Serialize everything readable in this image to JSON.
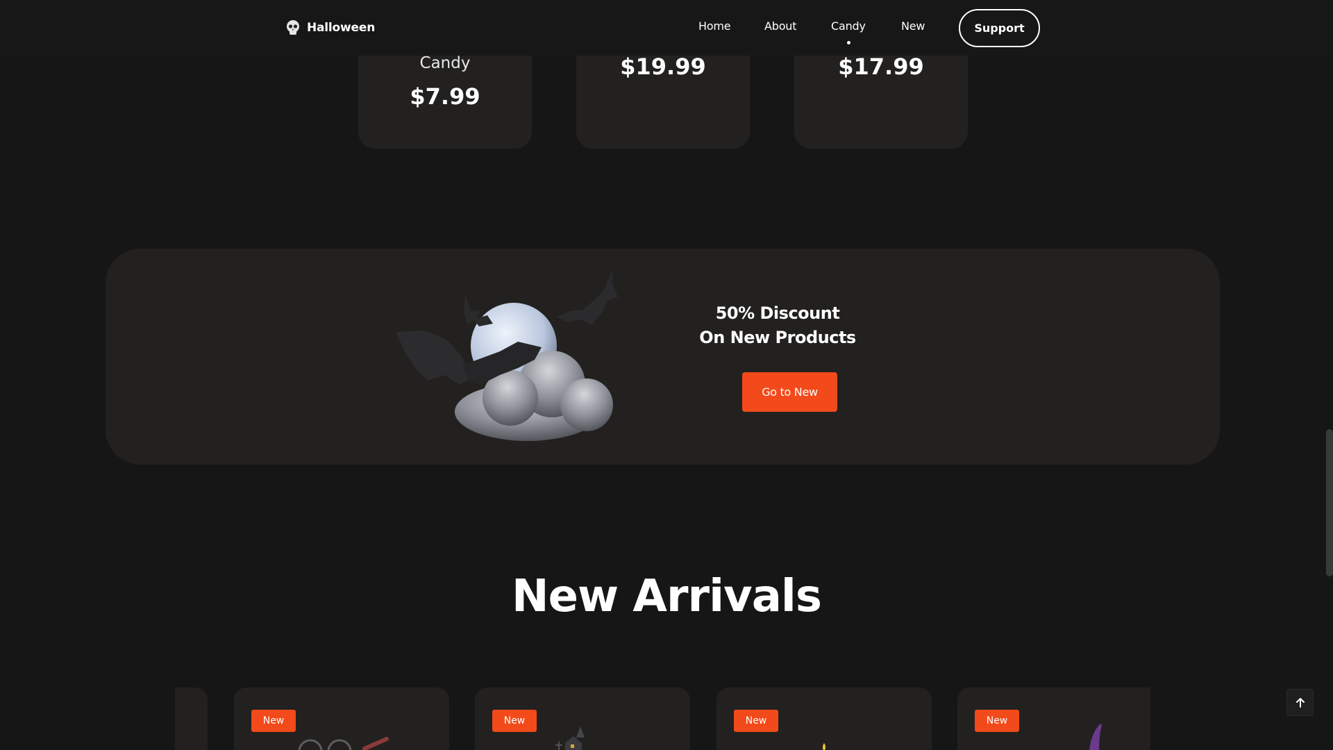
{
  "header": {
    "logo_text": "Halloween",
    "logo_icon": "skull-icon",
    "nav": [
      {
        "label": "Home"
      },
      {
        "label": "About"
      },
      {
        "label": "Candy",
        "active": true
      },
      {
        "label": "New"
      }
    ],
    "support_label": "Support"
  },
  "top_cards": [
    {
      "name": "Candy",
      "price": "$7.99"
    },
    {
      "price": "$19.99"
    },
    {
      "price": "$17.99"
    }
  ],
  "banner": {
    "line1": "50% Discount",
    "line2": "On New Products",
    "button_label": "Go to New",
    "image": "moon-bats-cloud"
  },
  "new_arrivals": {
    "title": "New Arrivals",
    "badge": "New",
    "items": [
      {
        "badge": "New",
        "image": "glasses-product"
      },
      {
        "badge": "New",
        "image": "haunted-house-product"
      },
      {
        "badge": "New",
        "image": "candle-product"
      },
      {
        "badge": "New",
        "image": "witch-hat-product"
      }
    ]
  },
  "colors": {
    "background": "#161616",
    "card": "#222120",
    "accent": "#f24a1a",
    "text": "#ffffff"
  },
  "back_to_top_icon": "arrow-up-icon"
}
